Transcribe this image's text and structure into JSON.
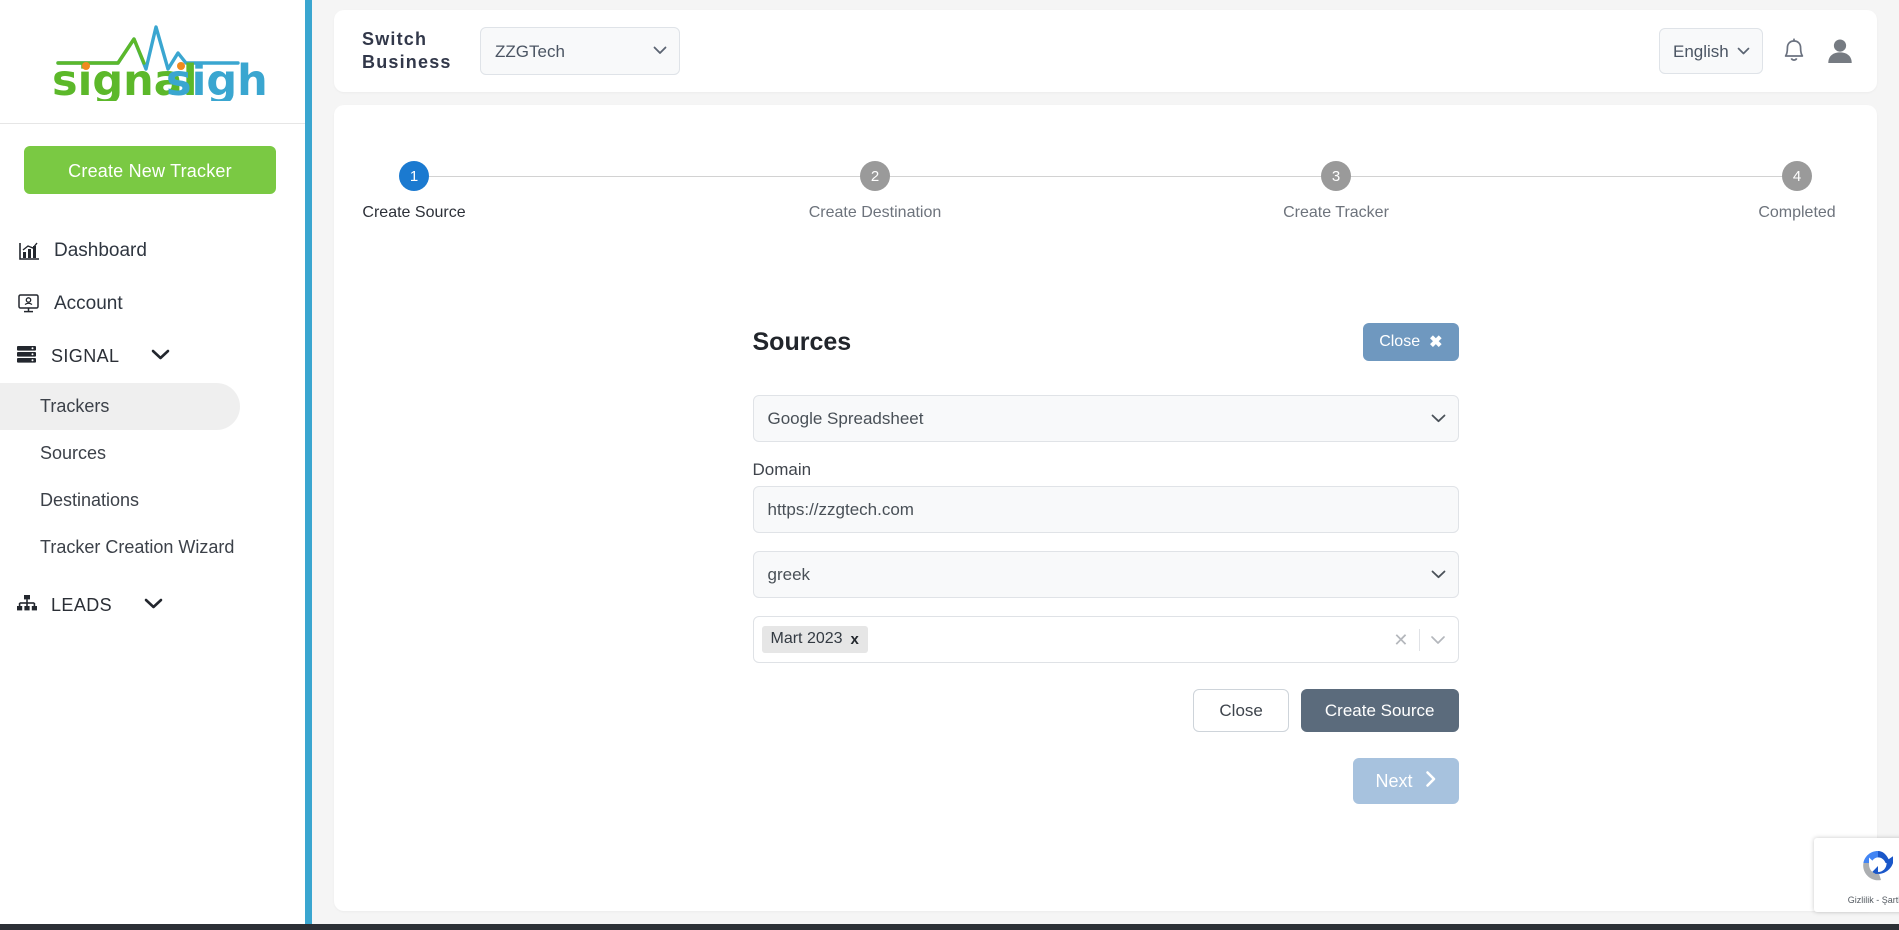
{
  "brand": {
    "name_part1": "signal",
    "name_part2": "sight",
    "color_green": "#5cb82a",
    "color_blue": "#3aa6d0",
    "color_orange": "#f08a1e"
  },
  "sidebar": {
    "create_button": "Create New Tracker",
    "items": [
      {
        "label": "Dashboard",
        "icon": "chart-bar-icon"
      },
      {
        "label": "Account",
        "icon": "monitor-user-icon"
      }
    ],
    "groups": [
      {
        "label": "SIGNAL",
        "icon": "server-icon",
        "expanded": true,
        "children": [
          {
            "label": "Trackers",
            "active": true
          },
          {
            "label": "Sources",
            "active": false
          },
          {
            "label": "Destinations",
            "active": false
          },
          {
            "label": "Tracker Creation Wizard",
            "active": false
          }
        ]
      },
      {
        "label": "LEADS",
        "icon": "sitemap-icon",
        "expanded": false,
        "children": []
      }
    ]
  },
  "topbar": {
    "switch_business_label": "Switch\nBusiness",
    "switch_business_line1": "Switch",
    "switch_business_line2": "Business",
    "business_selected": "ZZGTech",
    "business_options": [
      "ZZGTech"
    ],
    "language_selected": "English",
    "language_options": [
      "English"
    ],
    "notification_icon": "bell-icon",
    "profile_icon": "user-avatar-icon"
  },
  "stepper": {
    "steps": [
      {
        "number": "1",
        "label": "Create Source",
        "state": "active"
      },
      {
        "number": "2",
        "label": "Create Destination",
        "state": "inactive"
      },
      {
        "number": "3",
        "label": "Create Tracker",
        "state": "inactive"
      },
      {
        "number": "4",
        "label": "Completed",
        "state": "inactive"
      }
    ],
    "active_color": "#1b7ad0",
    "inactive_color": "#9a9a9a"
  },
  "panel": {
    "title": "Sources",
    "close_button": "Close",
    "close_icon": "close-x-icon",
    "source_type_selected": "Google Spreadsheet",
    "source_type_options": [
      "Google Spreadsheet"
    ],
    "domain_label": "Domain",
    "domain_value": "https://zzgtech.com",
    "language_selected": "greek",
    "language_options": [
      "greek"
    ],
    "tags": [
      "Mart 2023"
    ],
    "tag_remove_icon": "x-icon",
    "multiselect_clear_icon": "clear-x-icon",
    "multiselect_caret_icon": "chevron-down-icon",
    "footer_close_button": "Close",
    "create_source_button": "Create Source",
    "next_button": "Next",
    "next_icon": "chevron-right-icon"
  },
  "recaptcha": {
    "text": "Gizlilik - Şartlar",
    "icon": "recaptcha-icon"
  }
}
